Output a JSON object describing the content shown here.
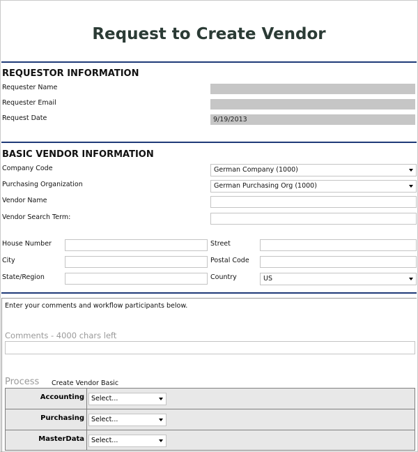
{
  "page": {
    "title": "Request to Create Vendor"
  },
  "requestor": {
    "section_title": "REQUESTOR INFORMATION",
    "name_label": "Requester Name",
    "name_value": "",
    "email_label": "Requester Email",
    "email_value": "",
    "date_label": "Request Date",
    "date_value": "9/19/2013"
  },
  "vendor": {
    "section_title": "BASIC VENDOR INFORMATION",
    "company_code_label": "Company Code",
    "company_code_value": "German Company (1000)",
    "purch_org_label": "Purchasing Organization",
    "purch_org_value": "German Purchasing Org (1000)",
    "vendor_name_label": "Vendor Name",
    "search_term_label": "Vendor Search Term:",
    "house_number_label": "House Number",
    "street_label": "Street",
    "city_label": "City",
    "postal_code_label": "Postal Code",
    "state_label": "State/Region",
    "country_label": "Country",
    "country_value": "US"
  },
  "workflow": {
    "instructions": "Enter your comments and workflow participants below.",
    "comments_label": "Comments   -   4000 chars left",
    "process_label": "Process",
    "process_name": "Create Vendor Basic",
    "rows": [
      {
        "role": "Accounting",
        "select": "Select..."
      },
      {
        "role": "Purchasing",
        "select": "Select..."
      },
      {
        "role": "MasterData",
        "select": "Select..."
      }
    ]
  }
}
